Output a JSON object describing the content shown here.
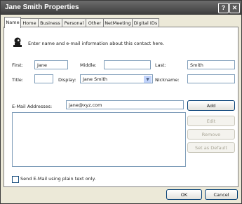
{
  "window": {
    "title": "Jane Smith Properties",
    "help_glyph": "?",
    "close_glyph": "✕"
  },
  "tabs": [
    {
      "label": "Name"
    },
    {
      "label": "Home"
    },
    {
      "label": "Business"
    },
    {
      "label": "Personal"
    },
    {
      "label": "Other"
    },
    {
      "label": "NetMeeting"
    },
    {
      "label": "Digital IDs"
    }
  ],
  "intro": {
    "text": "Enter name and e-mail information about this contact here.",
    "icon": "contact-card-icon"
  },
  "name": {
    "first_label": "First:",
    "first_value": "Jane",
    "middle_label": "Middle:",
    "middle_value": "",
    "last_label": "Last:",
    "last_value": "Smith",
    "title_label": "Title:",
    "title_value": "",
    "display_label": "Display:",
    "display_value": "Jane Smith",
    "nickname_label": "Nickname:",
    "nickname_value": ""
  },
  "email": {
    "label": "E-Mail Addresses:",
    "value": "jane@xyz.com",
    "list_items": [],
    "add_label": "Add",
    "edit_label": "Edit",
    "remove_label": "Remove",
    "default_label": "Set as Default"
  },
  "plain_text": {
    "label": "Send E-Mail using plain text only.",
    "checked": false
  },
  "footer": {
    "ok_label": "OK",
    "cancel_label": "Cancel"
  },
  "colors": {
    "titlebar": "#3c3c3c",
    "dialog_bg": "#ece9d8",
    "panel_bg": "#ffffff",
    "field_border": "#7f9db9"
  }
}
